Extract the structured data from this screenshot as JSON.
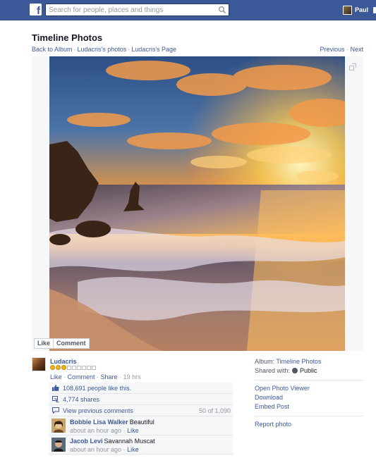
{
  "topbar": {
    "logo_letter": "f",
    "search_placeholder": "Search for people, places and things",
    "user_name": "Paul"
  },
  "header": {
    "title": "Timeline Photos",
    "breadcrumbs": [
      "Back to Album",
      "Ludacris's photos",
      "Ludacris's Page"
    ],
    "previous": "Previous",
    "next": "Next"
  },
  "photo_actions": {
    "like": "Like",
    "comment": "Comment"
  },
  "post": {
    "author": "Ludacris",
    "medals": 3,
    "empty_slots": 6,
    "meta": {
      "like": "Like",
      "comment": "Comment",
      "share": "Share",
      "time": "19 hrs"
    },
    "likes_text": "108,691 people like this.",
    "shares_text": "4,774 shares",
    "view_previous": "View previous comments",
    "comment_count": "50 of 1,090",
    "comments": [
      {
        "name": "Bobbie Lisa Walker",
        "text": "Beautiful",
        "time": "about an hour ago",
        "like": "Like"
      },
      {
        "name": "Jacob Levi",
        "text": "Savannah Muscat",
        "time": "about an hour ago",
        "like": "Like"
      }
    ]
  },
  "side": {
    "album_label": "Album:",
    "album_value": "Timeline Photos",
    "shared_label": "Shared with:",
    "shared_value": "Public",
    "links": [
      "Open Photo Viewer",
      "Download",
      "Embed Post"
    ],
    "report": "Report photo"
  },
  "colors": {
    "brand": "#3b5998",
    "link": "#3b5998",
    "muted": "#9197a3"
  }
}
